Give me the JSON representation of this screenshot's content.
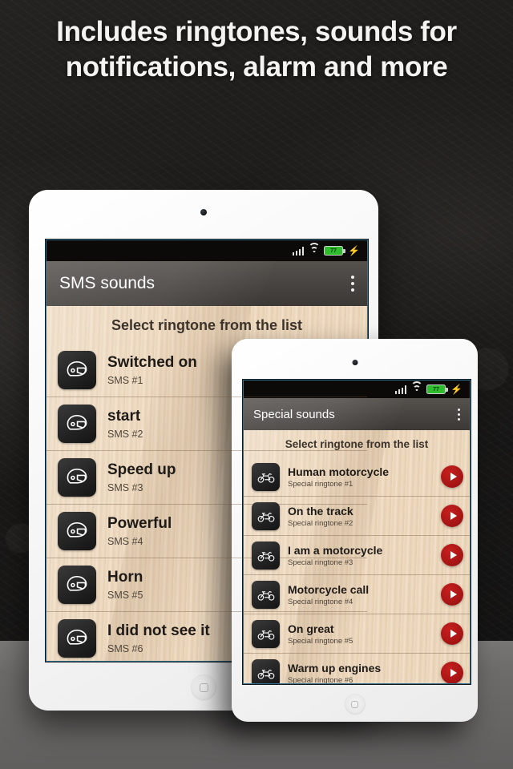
{
  "headline": "Includes ringtones, sounds for notifications, alarm and more",
  "theme": {
    "background": "#1d1c1b",
    "floor": "#6d6b6a",
    "wood": "#ecd9c0",
    "actionbar": "#474340",
    "play_button": "#a71514",
    "battery": "#2dbd2d",
    "headline_color": "#f4f3f2"
  },
  "status_bar": {
    "battery_level": "77",
    "charging": true,
    "signal_icon": "signal-bars-icon",
    "wifi_icon": "wifi-icon",
    "battery_icon": "battery-icon",
    "charging_icon": "lightning-bolt-icon"
  },
  "tablet_back": {
    "device": "white tablet",
    "app": {
      "title": "SMS sounds",
      "overflow_menu": "overflow-menu-icon",
      "list_header": "Select ringtone from the list",
      "items": [
        {
          "title": "Switched on",
          "subtitle": "SMS #1",
          "icon": "helmet-icon"
        },
        {
          "title": "start",
          "subtitle": "SMS #2",
          "icon": "helmet-icon"
        },
        {
          "title": "Speed up",
          "subtitle": "SMS #3",
          "icon": "helmet-icon"
        },
        {
          "title": "Powerful",
          "subtitle": "SMS #4",
          "icon": "helmet-icon"
        },
        {
          "title": "Horn",
          "subtitle": "SMS #5",
          "icon": "helmet-icon"
        },
        {
          "title": "I did not see it",
          "subtitle": "SMS #6",
          "icon": "helmet-icon"
        }
      ]
    }
  },
  "tablet_front": {
    "device": "white tablet",
    "app": {
      "title": "Special sounds",
      "overflow_menu": "overflow-menu-icon",
      "list_header": "Select ringtone from the list",
      "items": [
        {
          "title": "Human motorcycle",
          "subtitle": "Special ringtone #1",
          "icon": "motorcycle-icon"
        },
        {
          "title": "On the track",
          "subtitle": "Special ringtone #2",
          "icon": "motorcycle-icon"
        },
        {
          "title": "I am a motorcycle",
          "subtitle": "Special ringtone #3",
          "icon": "motorcycle-icon"
        },
        {
          "title": "Motorcycle call",
          "subtitle": "Special ringtone #4",
          "icon": "motorcycle-icon"
        },
        {
          "title": "On great",
          "subtitle": "Special ringtone #5",
          "icon": "motorcycle-icon"
        },
        {
          "title": "Warm up engines",
          "subtitle": "Special ringtone #6",
          "icon": "motorcycle-icon"
        }
      ]
    }
  }
}
